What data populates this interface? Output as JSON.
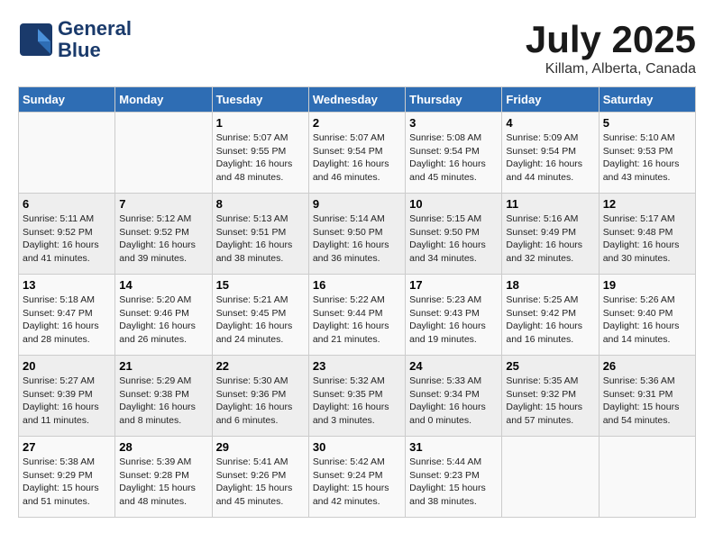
{
  "header": {
    "logo_line1": "General",
    "logo_line2": "Blue",
    "month": "July 2025",
    "location": "Killam, Alberta, Canada"
  },
  "weekdays": [
    "Sunday",
    "Monday",
    "Tuesday",
    "Wednesday",
    "Thursday",
    "Friday",
    "Saturday"
  ],
  "weeks": [
    [
      {
        "day": "",
        "detail": ""
      },
      {
        "day": "",
        "detail": ""
      },
      {
        "day": "1",
        "detail": "Sunrise: 5:07 AM\nSunset: 9:55 PM\nDaylight: 16 hours and 48 minutes."
      },
      {
        "day": "2",
        "detail": "Sunrise: 5:07 AM\nSunset: 9:54 PM\nDaylight: 16 hours and 46 minutes."
      },
      {
        "day": "3",
        "detail": "Sunrise: 5:08 AM\nSunset: 9:54 PM\nDaylight: 16 hours and 45 minutes."
      },
      {
        "day": "4",
        "detail": "Sunrise: 5:09 AM\nSunset: 9:54 PM\nDaylight: 16 hours and 44 minutes."
      },
      {
        "day": "5",
        "detail": "Sunrise: 5:10 AM\nSunset: 9:53 PM\nDaylight: 16 hours and 43 minutes."
      }
    ],
    [
      {
        "day": "6",
        "detail": "Sunrise: 5:11 AM\nSunset: 9:52 PM\nDaylight: 16 hours and 41 minutes."
      },
      {
        "day": "7",
        "detail": "Sunrise: 5:12 AM\nSunset: 9:52 PM\nDaylight: 16 hours and 39 minutes."
      },
      {
        "day": "8",
        "detail": "Sunrise: 5:13 AM\nSunset: 9:51 PM\nDaylight: 16 hours and 38 minutes."
      },
      {
        "day": "9",
        "detail": "Sunrise: 5:14 AM\nSunset: 9:50 PM\nDaylight: 16 hours and 36 minutes."
      },
      {
        "day": "10",
        "detail": "Sunrise: 5:15 AM\nSunset: 9:50 PM\nDaylight: 16 hours and 34 minutes."
      },
      {
        "day": "11",
        "detail": "Sunrise: 5:16 AM\nSunset: 9:49 PM\nDaylight: 16 hours and 32 minutes."
      },
      {
        "day": "12",
        "detail": "Sunrise: 5:17 AM\nSunset: 9:48 PM\nDaylight: 16 hours and 30 minutes."
      }
    ],
    [
      {
        "day": "13",
        "detail": "Sunrise: 5:18 AM\nSunset: 9:47 PM\nDaylight: 16 hours and 28 minutes."
      },
      {
        "day": "14",
        "detail": "Sunrise: 5:20 AM\nSunset: 9:46 PM\nDaylight: 16 hours and 26 minutes."
      },
      {
        "day": "15",
        "detail": "Sunrise: 5:21 AM\nSunset: 9:45 PM\nDaylight: 16 hours and 24 minutes."
      },
      {
        "day": "16",
        "detail": "Sunrise: 5:22 AM\nSunset: 9:44 PM\nDaylight: 16 hours and 21 minutes."
      },
      {
        "day": "17",
        "detail": "Sunrise: 5:23 AM\nSunset: 9:43 PM\nDaylight: 16 hours and 19 minutes."
      },
      {
        "day": "18",
        "detail": "Sunrise: 5:25 AM\nSunset: 9:42 PM\nDaylight: 16 hours and 16 minutes."
      },
      {
        "day": "19",
        "detail": "Sunrise: 5:26 AM\nSunset: 9:40 PM\nDaylight: 16 hours and 14 minutes."
      }
    ],
    [
      {
        "day": "20",
        "detail": "Sunrise: 5:27 AM\nSunset: 9:39 PM\nDaylight: 16 hours and 11 minutes."
      },
      {
        "day": "21",
        "detail": "Sunrise: 5:29 AM\nSunset: 9:38 PM\nDaylight: 16 hours and 8 minutes."
      },
      {
        "day": "22",
        "detail": "Sunrise: 5:30 AM\nSunset: 9:36 PM\nDaylight: 16 hours and 6 minutes."
      },
      {
        "day": "23",
        "detail": "Sunrise: 5:32 AM\nSunset: 9:35 PM\nDaylight: 16 hours and 3 minutes."
      },
      {
        "day": "24",
        "detail": "Sunrise: 5:33 AM\nSunset: 9:34 PM\nDaylight: 16 hours and 0 minutes."
      },
      {
        "day": "25",
        "detail": "Sunrise: 5:35 AM\nSunset: 9:32 PM\nDaylight: 15 hours and 57 minutes."
      },
      {
        "day": "26",
        "detail": "Sunrise: 5:36 AM\nSunset: 9:31 PM\nDaylight: 15 hours and 54 minutes."
      }
    ],
    [
      {
        "day": "27",
        "detail": "Sunrise: 5:38 AM\nSunset: 9:29 PM\nDaylight: 15 hours and 51 minutes."
      },
      {
        "day": "28",
        "detail": "Sunrise: 5:39 AM\nSunset: 9:28 PM\nDaylight: 15 hours and 48 minutes."
      },
      {
        "day": "29",
        "detail": "Sunrise: 5:41 AM\nSunset: 9:26 PM\nDaylight: 15 hours and 45 minutes."
      },
      {
        "day": "30",
        "detail": "Sunrise: 5:42 AM\nSunset: 9:24 PM\nDaylight: 15 hours and 42 minutes."
      },
      {
        "day": "31",
        "detail": "Sunrise: 5:44 AM\nSunset: 9:23 PM\nDaylight: 15 hours and 38 minutes."
      },
      {
        "day": "",
        "detail": ""
      },
      {
        "day": "",
        "detail": ""
      }
    ]
  ]
}
